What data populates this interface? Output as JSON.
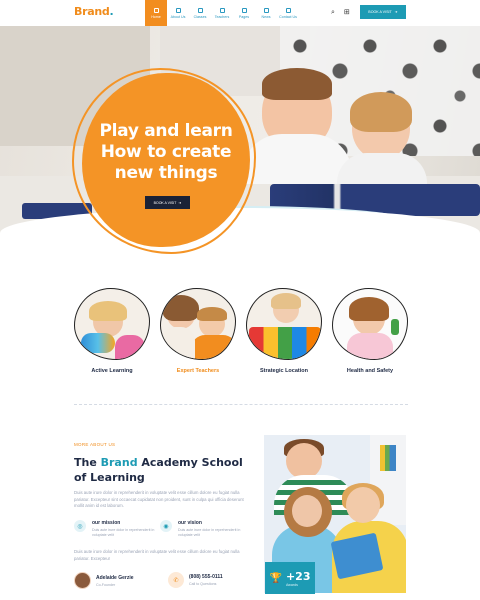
{
  "brand": {
    "name": "Brand",
    "dot": "."
  },
  "nav": {
    "items": [
      {
        "label": "Home",
        "icon": "home-icon",
        "active": true
      },
      {
        "label": "About Us",
        "icon": "info-icon",
        "active": false
      },
      {
        "label": "Classes",
        "icon": "book-icon",
        "active": false
      },
      {
        "label": "Teachers",
        "icon": "teacher-icon",
        "active": false
      },
      {
        "label": "Pages",
        "icon": "pages-icon",
        "active": false
      },
      {
        "label": "News",
        "icon": "news-icon",
        "active": false
      },
      {
        "label": "Contact Us",
        "icon": "mail-icon",
        "active": false
      }
    ],
    "search_icon": "⌕",
    "grid_icon": "⊞",
    "book_button": "BOOK A VISIT",
    "arrow": "➜"
  },
  "hero": {
    "title_line1": "Play and learn",
    "title_line2": "How to create",
    "title_line3": "new things",
    "button": "BOOK A VISIT"
  },
  "features": [
    {
      "label": "Active Learning",
      "highlight": false
    },
    {
      "label": "Expert Teachers",
      "highlight": true
    },
    {
      "label": "Strategic Location",
      "highlight": false
    },
    {
      "label": "Health and Safety",
      "highlight": false
    }
  ],
  "about": {
    "eyebrow": "MORE ABOUT US",
    "title_pre": "The ",
    "title_hl": "Brand",
    "title_post": " Academy School of Learning",
    "p1": "Duis aute irure dolor in reprehenderit in voluptate velit esse cillum dolore eu fugiat nulla pariatur. Excepteur sint occaecat cupidatat non proident, sunt in culpa qui officia deserunt mollit anim id est laborum.",
    "mission": {
      "title": "our mission",
      "text": "Duis aute irure dolor in reprehenderit in voluptate velit"
    },
    "vision": {
      "title": "our vision",
      "text": "Duis aute irure dolor in reprehenderit in voluptate velit"
    },
    "p2": "Duis aute irure dolor in reprehenderit in voluptate velit esse cillum dolore eu fugiat nulla pariatur. Excepteur",
    "person_name": "Adelaide Gerzie",
    "person_role": "Co-Founder",
    "phone": "(808) 555-0111",
    "phone_label": "Call to Questions",
    "badge_value": "+23",
    "badge_label": "Awards"
  }
}
